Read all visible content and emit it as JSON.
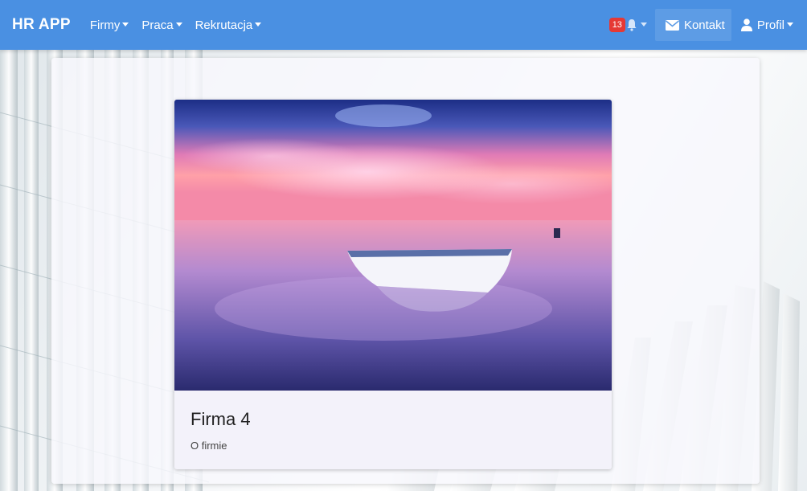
{
  "navbar": {
    "brand": "HR APP",
    "menus": [
      {
        "label": "Firmy"
      },
      {
        "label": "Praca"
      },
      {
        "label": "Rekrutacja"
      }
    ],
    "notifications": {
      "count": "13",
      "icon": "bell-icon"
    },
    "contact_label": "Kontakt",
    "profile_label": "Profil",
    "color": "#4a90e2"
  },
  "card": {
    "title": "Firma 4",
    "text": "O firmie",
    "image": "sunset-boat-on-water"
  },
  "colors": {
    "navbar": "#4a90e2",
    "badge": "#e53935"
  }
}
